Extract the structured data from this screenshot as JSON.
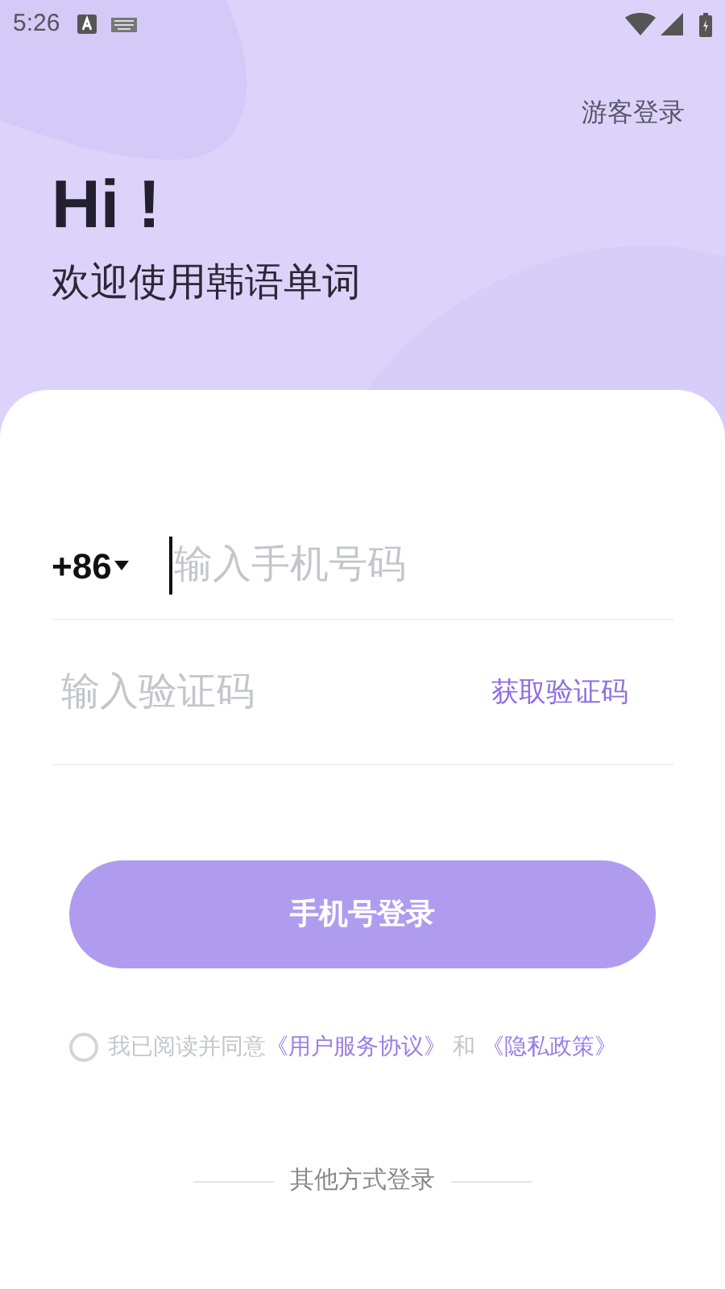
{
  "status_bar": {
    "time": "5:26"
  },
  "header": {
    "guest_login": "游客登录",
    "greeting": "Hi !",
    "welcome": "欢迎使用韩语单词"
  },
  "phone": {
    "country_code": "+86",
    "placeholder": "输入手机号码"
  },
  "code": {
    "placeholder": "输入验证码",
    "get_code": "获取验证码"
  },
  "login_button": {
    "label": "手机号登录",
    "disabled": true
  },
  "agreement": {
    "checked": false,
    "prefix": "我已阅读并同意",
    "link_1": "《用户服务协议》",
    "joiner": "和",
    "link_2": "《隐私政策》"
  },
  "other_login": {
    "label": "其他方式登录"
  }
}
